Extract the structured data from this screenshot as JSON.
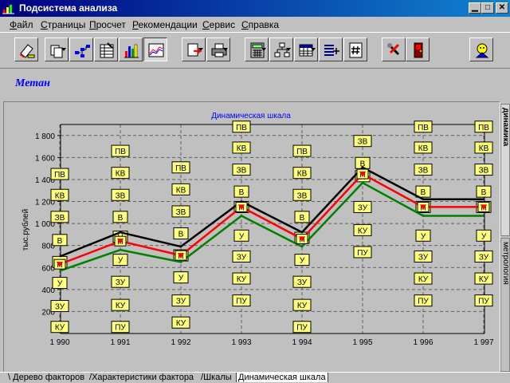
{
  "window": {
    "title": "Подсистема анализа"
  },
  "menu": [
    {
      "label": "Файл",
      "u": "Ф",
      "rest": "айл"
    },
    {
      "label": "Страницы",
      "u": "С",
      "rest": "траницы"
    },
    {
      "label": "Просчет",
      "u": "П",
      "rest": "росчет"
    },
    {
      "label": "Рекомендации",
      "u": "Р",
      "rest": "екомендации"
    },
    {
      "label": "Сервис",
      "u": "С",
      "rest": "ервис"
    },
    {
      "label": "Справка",
      "u": "С",
      "rest": "правка"
    }
  ],
  "subject": "Метан",
  "side_tabs": [
    "динамика",
    "метрология"
  ],
  "bottom_tabs": [
    "Дерево факторов",
    "Характеристики фактора",
    "Шкалы",
    "Динамическая шкала"
  ],
  "chart_data": {
    "type": "line",
    "title": "Динамическая шкала",
    "xlabel": "",
    "ylabel": "тыс.рублей",
    "categories": [
      "1 990",
      "1 991",
      "1 992",
      "1 993",
      "1 994",
      "1 995",
      "1 996",
      "1 997"
    ],
    "y_ticks": [
      "200",
      "400",
      "600",
      "800",
      "1 000",
      "1 200",
      "1 400",
      "1 600",
      "1 800"
    ],
    "ylim": [
      0,
      1900
    ],
    "grid": true,
    "series": [
      {
        "color": "#000000",
        "values": [
          700,
          920,
          790,
          1200,
          920,
          1510,
          1220,
          1220
        ]
      },
      {
        "color": "#ff0000",
        "values": [
          630,
          840,
          710,
          1150,
          860,
          1450,
          1150,
          1150
        ]
      },
      {
        "color": "#008000",
        "values": [
          570,
          760,
          650,
          1070,
          790,
          1370,
          1070,
          1070
        ]
      }
    ],
    "markers": [
      "Н",
      "Н",
      "Н",
      "Н",
      "Н",
      "Н",
      "Н",
      "Н"
    ],
    "scale_labels": [
      "ПВ",
      "КВ",
      "ЗВ",
      "В",
      "Н",
      "У",
      "ЗУ",
      "КУ",
      "ПУ"
    ],
    "scale_columns": [
      [
        [
          "ПВ",
          1450
        ],
        [
          "КВ",
          1260
        ],
        [
          "ЗВ",
          1060
        ],
        [
          "В",
          850
        ],
        [
          "Н",
          650
        ],
        [
          "У",
          460
        ],
        [
          "ЗУ",
          250
        ],
        [
          "КУ",
          60
        ]
      ],
      [
        [
          "ПВ",
          1660
        ],
        [
          "КВ",
          1460
        ],
        [
          "ЗВ",
          1260
        ],
        [
          "В",
          1060
        ],
        [
          "Н",
          880
        ],
        [
          "У",
          670
        ],
        [
          "ЗУ",
          470
        ],
        [
          "КУ",
          260
        ],
        [
          "ПУ",
          60
        ]
      ],
      [
        [
          "ПВ",
          1510
        ],
        [
          "КВ",
          1310
        ],
        [
          "ЗВ",
          1110
        ],
        [
          "В",
          910
        ],
        [
          "Н",
          710
        ],
        [
          "У",
          510
        ],
        [
          "ЗУ",
          300
        ],
        [
          "КУ",
          100
        ]
      ],
      [
        [
          "ПВ",
          1880
        ],
        [
          "КВ",
          1690
        ],
        [
          "ЗВ",
          1490
        ],
        [
          "В",
          1290
        ],
        [
          "Н",
          1150
        ],
        [
          "У",
          890
        ],
        [
          "ЗУ",
          700
        ],
        [
          "КУ",
          500
        ],
        [
          "ПУ",
          300
        ]
      ],
      [
        [
          "ПВ",
          1660
        ],
        [
          "КВ",
          1460
        ],
        [
          "ЗВ",
          1260
        ],
        [
          "В",
          1060
        ],
        [
          "Н",
          870
        ],
        [
          "У",
          670
        ],
        [
          "ЗУ",
          470
        ],
        [
          "КУ",
          260
        ],
        [
          "ПУ",
          60
        ]
      ],
      [
        [
          "ЗВ",
          1750
        ],
        [
          "В",
          1550
        ],
        [
          "Н",
          1430
        ],
        [
          "ЗУ",
          1150
        ],
        [
          "КУ",
          940
        ],
        [
          "ПУ",
          740
        ]
      ],
      [
        [
          "ПВ",
          1880
        ],
        [
          "КВ",
          1690
        ],
        [
          "ЗВ",
          1490
        ],
        [
          "В",
          1290
        ],
        [
          "Н",
          1150
        ],
        [
          "У",
          890
        ],
        [
          "ЗУ",
          700
        ],
        [
          "КУ",
          500
        ],
        [
          "ПУ",
          300
        ]
      ],
      [
        [
          "ПВ",
          1880
        ],
        [
          "КВ",
          1690
        ],
        [
          "ЗВ",
          1490
        ],
        [
          "В",
          1290
        ],
        [
          "Н",
          1150
        ],
        [
          "У",
          890
        ],
        [
          "ЗУ",
          700
        ],
        [
          "КУ",
          500
        ],
        [
          "ПУ",
          300
        ]
      ]
    ]
  }
}
